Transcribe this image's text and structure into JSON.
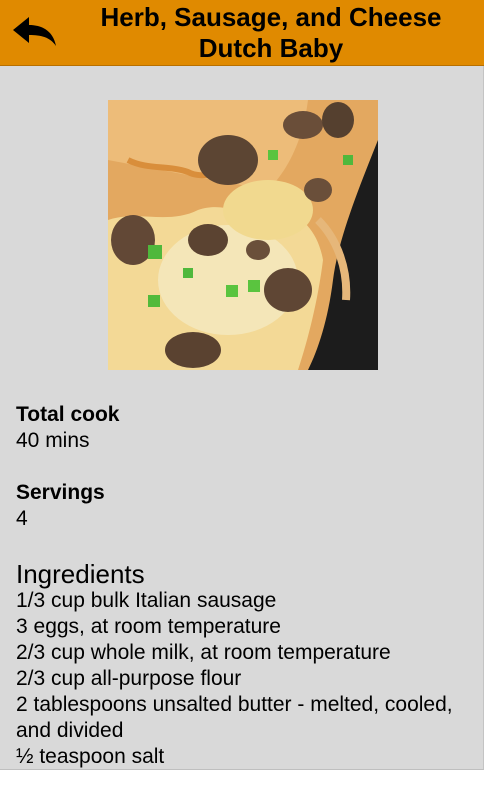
{
  "header": {
    "title": "Herb, Sausage, and Cheese Dutch Baby",
    "back_icon": "back-arrow-icon",
    "background_color": "#e08a00"
  },
  "recipe": {
    "photo": "dutch-baby-photo",
    "total_cook_label": "Total cook",
    "total_cook_value": "40 mins",
    "servings_label": "Servings",
    "servings_value": "4",
    "ingredients_heading": "Ingredients",
    "ingredients": [
      "1/3 cup bulk Italian sausage",
      "3 eggs, at room temperature",
      "2/3 cup whole milk, at room temperature",
      "2/3 cup all-purpose flour",
      "2 tablespoons unsalted butter - melted, cooled, and divided",
      "½ teaspoon salt"
    ]
  }
}
